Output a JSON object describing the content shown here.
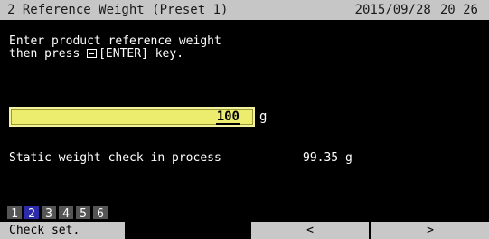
{
  "header": {
    "title": "2 Reference Weight (Preset 1)",
    "date": "2015/09/28",
    "time": "20 26"
  },
  "instructions": {
    "line1": "Enter product reference weight",
    "line2_prefix": "then press",
    "line2_suffix": "[ENTER] key.",
    "enter_icon": "enter-key-icon"
  },
  "weight_input": {
    "value": "100",
    "unit": "g"
  },
  "status": {
    "label": "Static weight check in process",
    "value": "99.35 g"
  },
  "presets": {
    "items": [
      "1",
      "2",
      "3",
      "4",
      "5",
      "6"
    ],
    "active": "2"
  },
  "footer": {
    "check_set": "Check set.",
    "prev": "<",
    "next": ">"
  },
  "colors": {
    "header_bg": "#c6c6c6",
    "field_bg": "#ecec6e",
    "active_preset": "#2c2caa",
    "button_bg": "#c8c8c8"
  }
}
